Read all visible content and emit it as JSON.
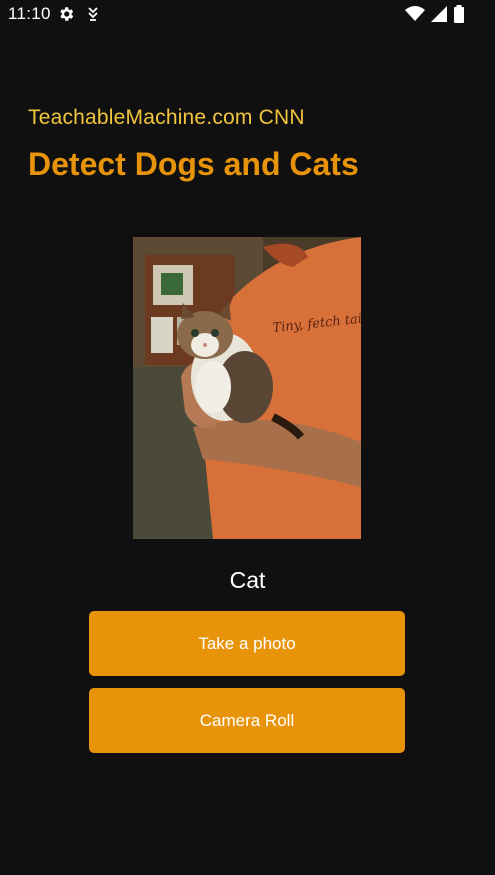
{
  "status_bar": {
    "time": "11:10",
    "icons": [
      "gear-icon",
      "download-icon",
      "wifi-icon",
      "signal-icon",
      "battery-icon"
    ]
  },
  "header": {
    "subtitle": "TeachableMachine.com CNN",
    "title": "Detect Dogs and Cats"
  },
  "photo": {
    "shirt_text": "Tiny, fetch tail."
  },
  "result": {
    "label": "Cat"
  },
  "buttons": {
    "take_photo": "Take a photo",
    "camera_roll": "Camera Roll"
  },
  "colors": {
    "background": "#101010",
    "accent": "#e8940b",
    "subtitle": "#f2c53d"
  }
}
